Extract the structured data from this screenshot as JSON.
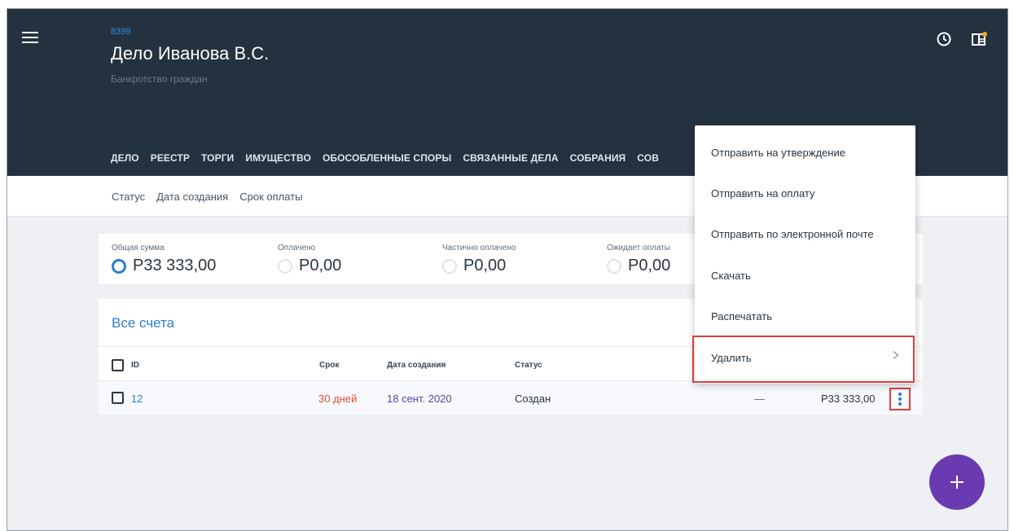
{
  "header": {
    "case_id": "8399",
    "title": "Дело Иванова В.С.",
    "subtitle": "Банкротство граждан",
    "background": "#243240"
  },
  "tabs": [
    "ДЕЛО",
    "РЕЕСТР",
    "ТОРГИ",
    "ИМУЩЕСТВО",
    "ОБОСОБЛЕННЫЕ СПОРЫ",
    "СВЯЗАННЫЕ ДЕЛА",
    "СОБРАНИЯ",
    "СОВ"
  ],
  "filters": [
    "Статус",
    "Дата создания",
    "Срок оплаты"
  ],
  "summary": {
    "total": {
      "label": "Общая сумма",
      "value": "Р33 333,00"
    },
    "paid": {
      "label": "Оплачено",
      "value": "Р0,00"
    },
    "partial": {
      "label": "Частично оплачено",
      "value": "Р0,00"
    },
    "pending": {
      "label": "Ожидает оплаты",
      "value": "Р0,00"
    }
  },
  "invoices": {
    "title": "Все счета",
    "columns": {
      "id": "ID",
      "term": "Срок",
      "created": "Дата создания",
      "status": "Статус"
    },
    "rows": [
      {
        "id": "12",
        "term": "30 дней",
        "created": "18 сент. 2020",
        "status": "Создан",
        "dash": "—",
        "amount": "Р33 333,00"
      }
    ]
  },
  "context_menu": {
    "items": [
      "Отправить на утверждение",
      "Отправить на оплату",
      "Отправить по электронной почте",
      "Скачать",
      "Распечатать",
      "Удалить"
    ]
  },
  "colors": {
    "accent": "#2b7dd6",
    "term_red": "#e04a3a",
    "date_purple": "#5b3fa8",
    "fab": "#6a3bb0",
    "highlight": "#e23b3b"
  },
  "icons": {
    "menu": "hamburger-icon",
    "history": "clock-icon",
    "panel": "sidebar-panel-icon",
    "more": "more-vertical-icon",
    "chevron": "chevron-right-icon",
    "add": "plus-icon"
  }
}
